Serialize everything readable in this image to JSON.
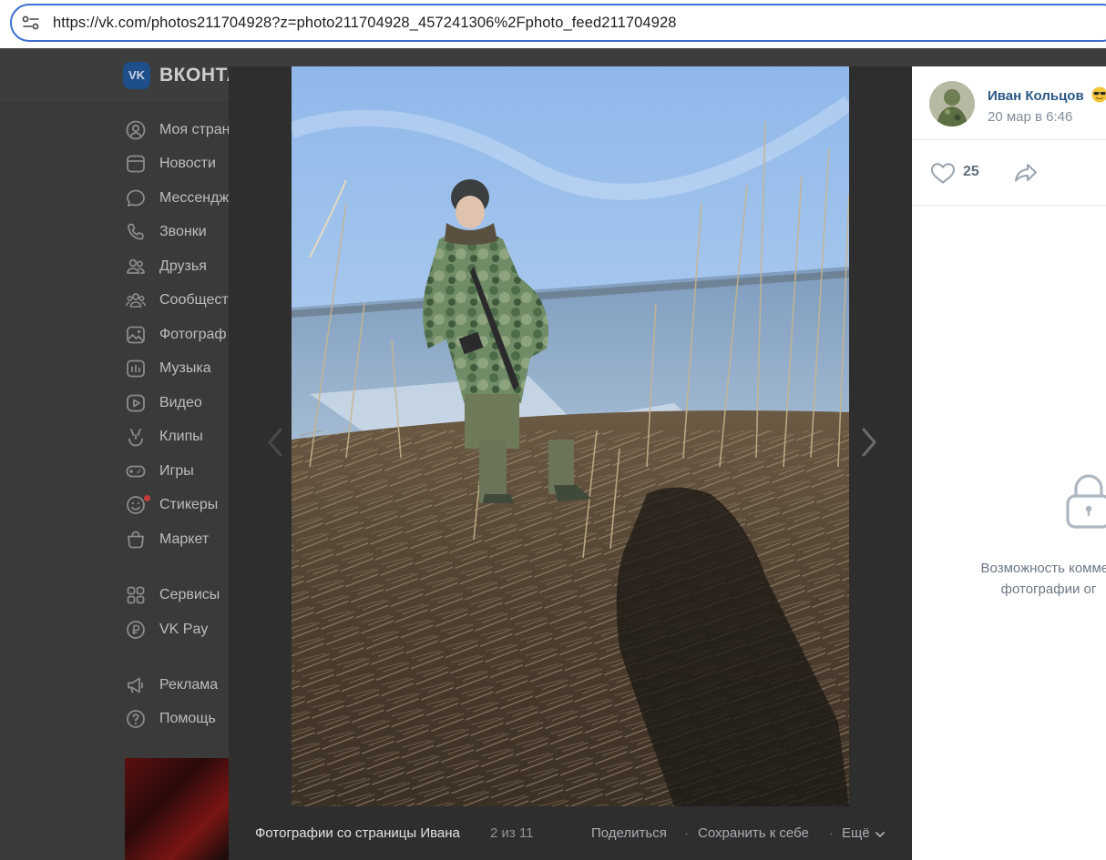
{
  "browser": {
    "url": "https://vk.com/photos211704928?z=photo211704928_457241306%2Fphoto_feed211704928"
  },
  "vk": {
    "logo_text": "VK",
    "brand_text": "ВКОНТА",
    "menu": [
      {
        "label": "Моя стран",
        "icon": "user-circle-icon"
      },
      {
        "label": "Новости",
        "icon": "news-icon"
      },
      {
        "label": "Мессендж",
        "icon": "message-icon"
      },
      {
        "label": "Звонки",
        "icon": "phone-icon"
      },
      {
        "label": "Друзья",
        "icon": "friends-icon"
      },
      {
        "label": "Сообщест",
        "icon": "communities-icon"
      },
      {
        "label": "Фотограф",
        "icon": "photo-icon"
      },
      {
        "label": "Музыка",
        "icon": "music-icon"
      },
      {
        "label": "Видео",
        "icon": "video-icon"
      },
      {
        "label": "Клипы",
        "icon": "clips-icon"
      },
      {
        "label": "Игры",
        "icon": "games-icon"
      },
      {
        "label": "Стикеры",
        "icon": "stickers-icon"
      },
      {
        "label": "Маркет",
        "icon": "market-icon"
      },
      {
        "label": "Сервисы",
        "icon": "services-icon"
      },
      {
        "label": "VK Pay",
        "icon": "vk-pay-icon"
      },
      {
        "label": "Реклама",
        "icon": "megaphone-icon"
      },
      {
        "label": "Помощь",
        "icon": "help-icon"
      }
    ]
  },
  "viewer": {
    "album_title": "Фотографии со страницы Ивана",
    "counter": "2 из 11",
    "share_label": "Поделиться",
    "separator": "·",
    "save_label": "Сохранить к себе",
    "more_label": "Ещё"
  },
  "info": {
    "author_name": "Иван Кольцов",
    "date": "20 мар в 6:46",
    "likes": "25",
    "comments_disabled_line1": "Возможность коммен",
    "comments_disabled_line2": "фотографии ог"
  },
  "colors": {
    "link": "#2a5885",
    "muted": "#818c99",
    "accent_address_bar": "#3f6ed4"
  }
}
